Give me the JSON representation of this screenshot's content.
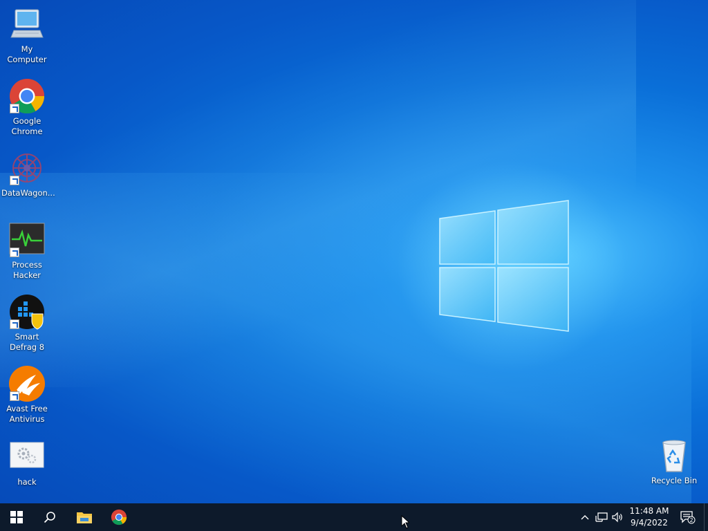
{
  "desktop": {
    "icons": [
      {
        "label": "My Computer",
        "icon": "computer-icon"
      },
      {
        "label": "Google Chrome",
        "icon": "chrome-icon"
      },
      {
        "label": "DataWagon...",
        "icon": "datawagon-icon"
      },
      {
        "label": "Process Hacker",
        "icon": "process-hacker-icon"
      },
      {
        "label": "Smart Defrag 8",
        "icon": "smart-defrag-icon"
      },
      {
        "label": "Avast Free Antivirus",
        "icon": "avast-icon"
      },
      {
        "label": "hack",
        "icon": "settings-file-icon"
      },
      {
        "label": "Recycle Bin",
        "icon": "recycle-bin-icon"
      }
    ]
  },
  "taskbar": {
    "pinned": [
      {
        "name": "start",
        "icon": "windows-icon"
      },
      {
        "name": "search",
        "icon": "search-icon"
      },
      {
        "name": "file-explorer",
        "icon": "folder-icon"
      },
      {
        "name": "chrome",
        "icon": "chrome-icon"
      }
    ],
    "tray": {
      "icons": [
        "chevron-up-icon",
        "network-icon",
        "volume-icon"
      ],
      "time": "11:48 AM",
      "date": "9/4/2022",
      "notifications_count": "2"
    }
  },
  "colors": {
    "wallpaper_deep": "#0648b6",
    "wallpaper_light": "#4fc3ff",
    "taskbar": "#0d1a2b",
    "avast": "#f57c00",
    "chrome_red": "#db4437",
    "chrome_green": "#0f9d58",
    "chrome_yellow": "#f4b400",
    "chrome_blue": "#4285f4"
  }
}
